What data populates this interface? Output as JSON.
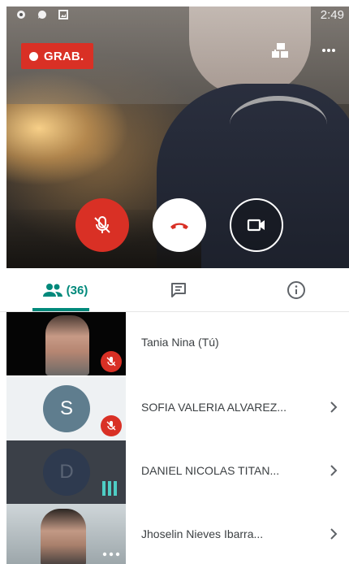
{
  "status_bar": {
    "time": "2:49",
    "icons": [
      "notification-icon",
      "message-icon",
      "image-icon"
    ]
  },
  "recording": {
    "label": "GRAB."
  },
  "top_actions": [
    "layout-switch-icon",
    "more-options-icon"
  ],
  "controls": {
    "mic": {
      "icon": "mic-off-icon",
      "state": "muted",
      "color": "#d93025"
    },
    "hangup": {
      "icon": "hangup-icon",
      "color": "#d93025"
    },
    "camera": {
      "icon": "video-camera-icon"
    }
  },
  "tabs": [
    {
      "name": "people",
      "icon": "people-icon",
      "count": "(36)",
      "selected": true
    },
    {
      "name": "chat",
      "icon": "chat-icon",
      "selected": false
    },
    {
      "name": "info",
      "icon": "info-icon",
      "selected": false
    }
  ],
  "participants": [
    {
      "name": "Tania Nina (Tú)",
      "thumb": "video",
      "mic": "muted",
      "chevron": false
    },
    {
      "name": "SOFIA VALERIA ALVAREZ...",
      "thumb": "avatar",
      "initial": "S",
      "avatar_color": "#5f7d8e",
      "mic": "muted",
      "chevron": true
    },
    {
      "name": "DANIEL NICOLAS TITAN...",
      "thumb": "avatar",
      "initial": "D",
      "avatar_color": "#2e3a4f",
      "mic": "speaking",
      "chevron": true
    },
    {
      "name": "Jhoselin Nieves Ibarra...",
      "thumb": "video",
      "mic": "more",
      "chevron": true
    }
  ],
  "colors": {
    "accent": "#00897b",
    "danger": "#d93025"
  }
}
